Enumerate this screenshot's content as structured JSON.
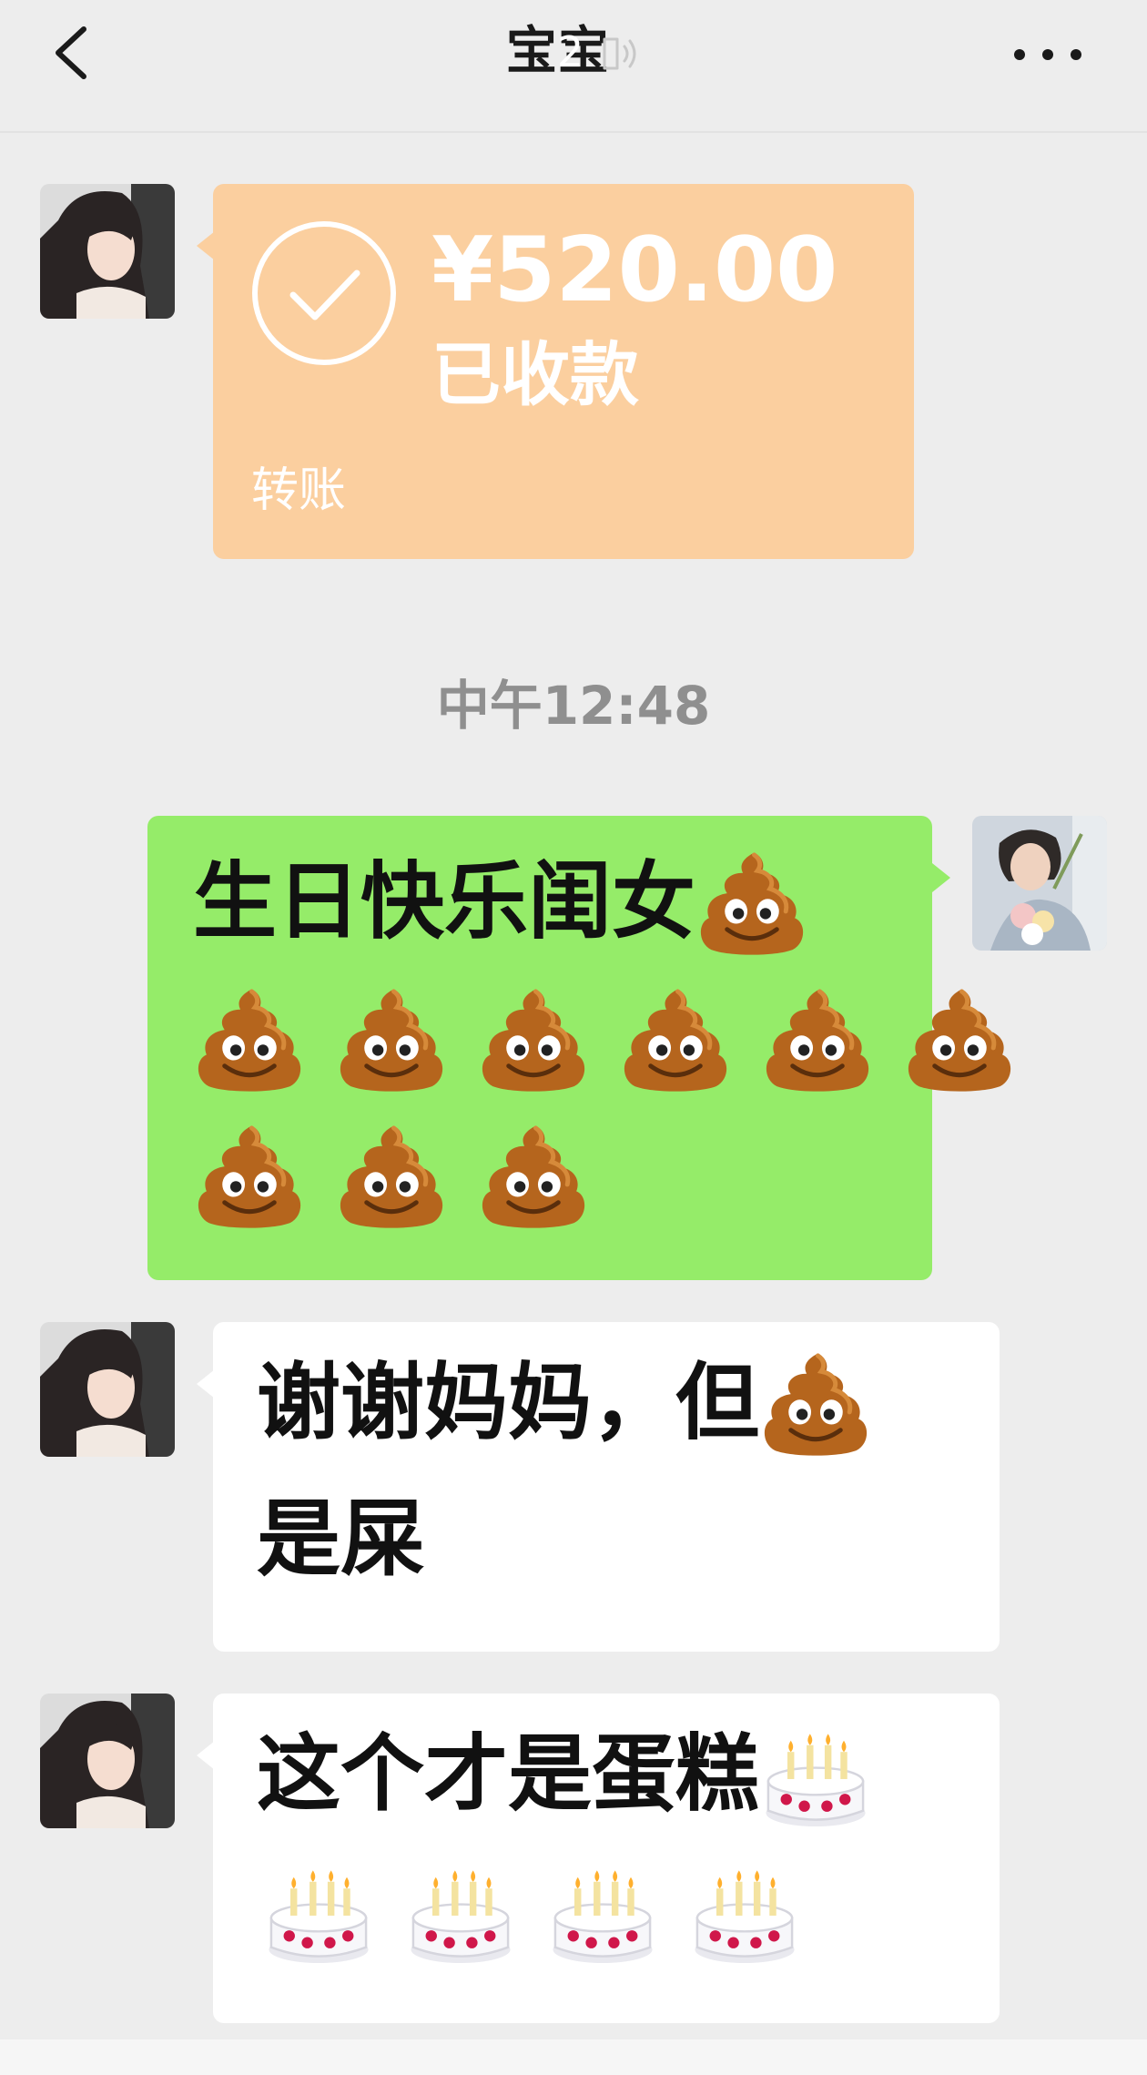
{
  "header": {
    "title": "宝宝",
    "unread_badge": "2",
    "back_icon": "chevron-left-icon",
    "muted_icon": "voice-icon",
    "more_icon": "more-dots-icon"
  },
  "messages": [
    {
      "type": "transfer",
      "sender": "other",
      "amount": "¥520.00",
      "status": "已收款",
      "label": "转账",
      "icon": "checkmark-circle-icon",
      "color": "#fbcf9f"
    },
    {
      "type": "timestamp",
      "text": "中午12:48"
    },
    {
      "type": "text",
      "sender": "me",
      "text": "生日快乐闺女",
      "emoji": "poop-emoji",
      "emoji_count": 10,
      "color": "#95ec69"
    },
    {
      "type": "text",
      "sender": "other",
      "text_line1": "谢谢妈妈，但",
      "text_line2": "是屎",
      "emoji": "poop-emoji",
      "emoji_count": 1
    },
    {
      "type": "text",
      "sender": "other",
      "text": "这个才是蛋糕",
      "emoji": "birthday-cake-emoji",
      "emoji_count": 5
    }
  ]
}
